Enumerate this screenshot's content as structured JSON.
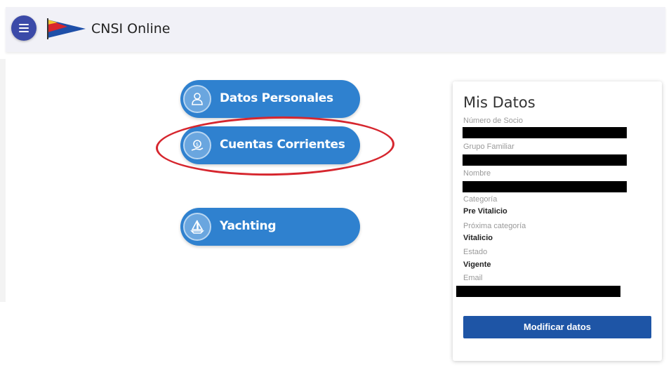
{
  "header": {
    "title": "CNSI Online"
  },
  "nav": {
    "buttons": [
      {
        "label": "Datos Personales",
        "icon": "person-icon"
      },
      {
        "label": "Cuentas Corrientes",
        "icon": "money-icon"
      },
      {
        "label": "Yachting",
        "icon": "sailboat-icon"
      }
    ]
  },
  "profile": {
    "title": "Mis Datos",
    "fields": {
      "numero_socio": {
        "label": "Número de Socio"
      },
      "grupo_familiar": {
        "label": "Grupo Familiar"
      },
      "nombre": {
        "label": "Nombre"
      },
      "categoria": {
        "label": "Categoría",
        "value": "Pre Vitalicio"
      },
      "proxima_categoria": {
        "label": "Próxima categoría",
        "value": "Vitalicio"
      },
      "estado": {
        "label": "Estado",
        "value": "Vigente"
      },
      "email": {
        "label": "Email"
      }
    },
    "modify_label": "Modificar datos"
  },
  "colors": {
    "primary_blue": "#2f81cf",
    "menu_button": "#3b4aa8",
    "modify_button": "#1e55a6",
    "highlight_red": "#d6262e"
  }
}
